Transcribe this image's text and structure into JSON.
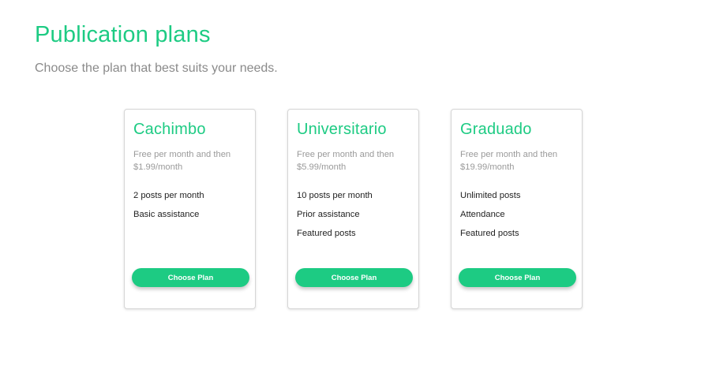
{
  "header": {
    "title": "Publication plans",
    "subtitle": "Choose the plan that best suits your needs."
  },
  "colors": {
    "accent": "#1dcb83",
    "muted_text": "#9a9a9a",
    "body_text": "#222222"
  },
  "plans": [
    {
      "name": "Cachimbo",
      "price_line1": "Free per month and then",
      "price_line2": "$1.99/month",
      "features": [
        "2 posts per month",
        "Basic assistance"
      ],
      "button_label": "Choose Plan"
    },
    {
      "name": "Universitario",
      "price_line1": "Free per month and then",
      "price_line2": "$5.99/month",
      "features": [
        "10 posts per month",
        "Prior assistance",
        "Featured posts"
      ],
      "button_label": "Choose Plan"
    },
    {
      "name": "Graduado",
      "price_line1": "Free per month and then",
      "price_line2": "$19.99/month",
      "features": [
        "Unlimited posts",
        "Attendance",
        "Featured posts"
      ],
      "button_label": "Choose Plan"
    }
  ]
}
